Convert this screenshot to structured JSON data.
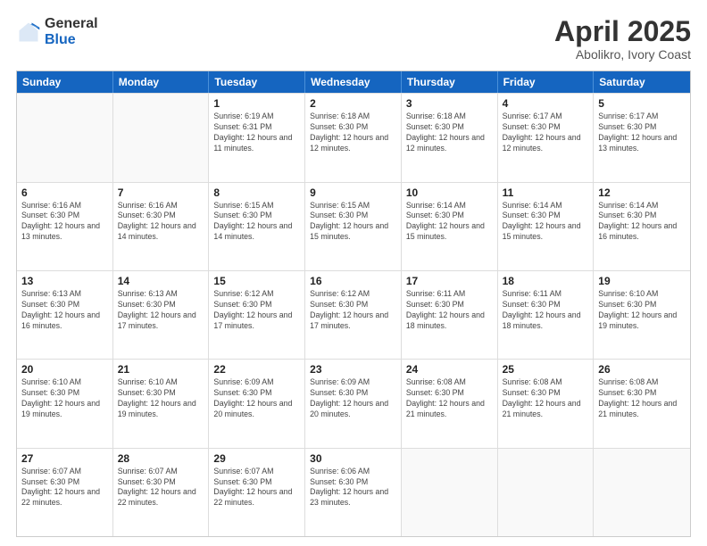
{
  "logo": {
    "general": "General",
    "blue": "Blue"
  },
  "title": "April 2025",
  "subtitle": "Abolikro, Ivory Coast",
  "header_days": [
    "Sunday",
    "Monday",
    "Tuesday",
    "Wednesday",
    "Thursday",
    "Friday",
    "Saturday"
  ],
  "weeks": [
    [
      {
        "day": "",
        "info": ""
      },
      {
        "day": "",
        "info": ""
      },
      {
        "day": "1",
        "info": "Sunrise: 6:19 AM\nSunset: 6:31 PM\nDaylight: 12 hours and 11 minutes."
      },
      {
        "day": "2",
        "info": "Sunrise: 6:18 AM\nSunset: 6:30 PM\nDaylight: 12 hours and 12 minutes."
      },
      {
        "day": "3",
        "info": "Sunrise: 6:18 AM\nSunset: 6:30 PM\nDaylight: 12 hours and 12 minutes."
      },
      {
        "day": "4",
        "info": "Sunrise: 6:17 AM\nSunset: 6:30 PM\nDaylight: 12 hours and 12 minutes."
      },
      {
        "day": "5",
        "info": "Sunrise: 6:17 AM\nSunset: 6:30 PM\nDaylight: 12 hours and 13 minutes."
      }
    ],
    [
      {
        "day": "6",
        "info": "Sunrise: 6:16 AM\nSunset: 6:30 PM\nDaylight: 12 hours and 13 minutes."
      },
      {
        "day": "7",
        "info": "Sunrise: 6:16 AM\nSunset: 6:30 PM\nDaylight: 12 hours and 14 minutes."
      },
      {
        "day": "8",
        "info": "Sunrise: 6:15 AM\nSunset: 6:30 PM\nDaylight: 12 hours and 14 minutes."
      },
      {
        "day": "9",
        "info": "Sunrise: 6:15 AM\nSunset: 6:30 PM\nDaylight: 12 hours and 15 minutes."
      },
      {
        "day": "10",
        "info": "Sunrise: 6:14 AM\nSunset: 6:30 PM\nDaylight: 12 hours and 15 minutes."
      },
      {
        "day": "11",
        "info": "Sunrise: 6:14 AM\nSunset: 6:30 PM\nDaylight: 12 hours and 15 minutes."
      },
      {
        "day": "12",
        "info": "Sunrise: 6:14 AM\nSunset: 6:30 PM\nDaylight: 12 hours and 16 minutes."
      }
    ],
    [
      {
        "day": "13",
        "info": "Sunrise: 6:13 AM\nSunset: 6:30 PM\nDaylight: 12 hours and 16 minutes."
      },
      {
        "day": "14",
        "info": "Sunrise: 6:13 AM\nSunset: 6:30 PM\nDaylight: 12 hours and 17 minutes."
      },
      {
        "day": "15",
        "info": "Sunrise: 6:12 AM\nSunset: 6:30 PM\nDaylight: 12 hours and 17 minutes."
      },
      {
        "day": "16",
        "info": "Sunrise: 6:12 AM\nSunset: 6:30 PM\nDaylight: 12 hours and 17 minutes."
      },
      {
        "day": "17",
        "info": "Sunrise: 6:11 AM\nSunset: 6:30 PM\nDaylight: 12 hours and 18 minutes."
      },
      {
        "day": "18",
        "info": "Sunrise: 6:11 AM\nSunset: 6:30 PM\nDaylight: 12 hours and 18 minutes."
      },
      {
        "day": "19",
        "info": "Sunrise: 6:10 AM\nSunset: 6:30 PM\nDaylight: 12 hours and 19 minutes."
      }
    ],
    [
      {
        "day": "20",
        "info": "Sunrise: 6:10 AM\nSunset: 6:30 PM\nDaylight: 12 hours and 19 minutes."
      },
      {
        "day": "21",
        "info": "Sunrise: 6:10 AM\nSunset: 6:30 PM\nDaylight: 12 hours and 19 minutes."
      },
      {
        "day": "22",
        "info": "Sunrise: 6:09 AM\nSunset: 6:30 PM\nDaylight: 12 hours and 20 minutes."
      },
      {
        "day": "23",
        "info": "Sunrise: 6:09 AM\nSunset: 6:30 PM\nDaylight: 12 hours and 20 minutes."
      },
      {
        "day": "24",
        "info": "Sunrise: 6:08 AM\nSunset: 6:30 PM\nDaylight: 12 hours and 21 minutes."
      },
      {
        "day": "25",
        "info": "Sunrise: 6:08 AM\nSunset: 6:30 PM\nDaylight: 12 hours and 21 minutes."
      },
      {
        "day": "26",
        "info": "Sunrise: 6:08 AM\nSunset: 6:30 PM\nDaylight: 12 hours and 21 minutes."
      }
    ],
    [
      {
        "day": "27",
        "info": "Sunrise: 6:07 AM\nSunset: 6:30 PM\nDaylight: 12 hours and 22 minutes."
      },
      {
        "day": "28",
        "info": "Sunrise: 6:07 AM\nSunset: 6:30 PM\nDaylight: 12 hours and 22 minutes."
      },
      {
        "day": "29",
        "info": "Sunrise: 6:07 AM\nSunset: 6:30 PM\nDaylight: 12 hours and 22 minutes."
      },
      {
        "day": "30",
        "info": "Sunrise: 6:06 AM\nSunset: 6:30 PM\nDaylight: 12 hours and 23 minutes."
      },
      {
        "day": "",
        "info": ""
      },
      {
        "day": "",
        "info": ""
      },
      {
        "day": "",
        "info": ""
      }
    ]
  ]
}
